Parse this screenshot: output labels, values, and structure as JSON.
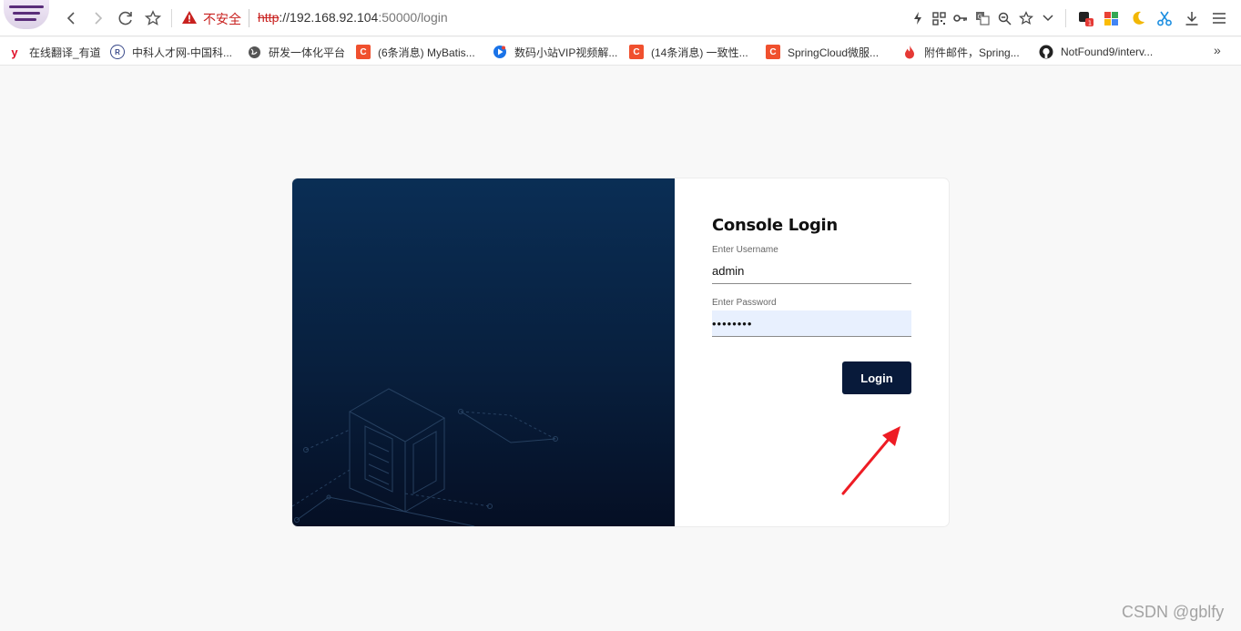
{
  "browser": {
    "address": {
      "security_label": "不安全",
      "url_scheme": "http",
      "url_host": "://192.168.92.104",
      "url_path": ":50000/login"
    },
    "icons": [
      "back-icon",
      "forward-icon",
      "reload-icon",
      "bookmark-star-icon",
      "warning-icon",
      "lightning-icon",
      "qr-code-icon",
      "key-icon",
      "translate-icon",
      "zoom-icon",
      "favorite-star-icon",
      "dropdown-icon",
      "extension-icon",
      "apps-grid-icon",
      "moon-icon",
      "scissors-icon",
      "download-icon",
      "menu-icon"
    ],
    "extension_badge": "1"
  },
  "bookmarks": [
    {
      "label": "在线翻译_有道",
      "icon": "youdao-icon",
      "color": "#e0102a"
    },
    {
      "label": "中科人才网-中国科...",
      "icon": "talent-icon",
      "color": "#3a4a8a"
    },
    {
      "label": "研发一体化平台",
      "icon": "globe-icon",
      "color": "#555555"
    },
    {
      "label": "(6条消息) MyBatis...",
      "icon": "csdn-icon",
      "color": "#f0502e"
    },
    {
      "label": "数码小站VIP视频解...",
      "icon": "video-icon",
      "color": "#1a73e8"
    },
    {
      "label": "(14条消息) 一致性...",
      "icon": "csdn-icon",
      "color": "#f0502e"
    },
    {
      "label": "SpringCloud微服...",
      "icon": "csdn-icon",
      "color": "#f0502e"
    },
    {
      "label": "附件邮件，Spring...",
      "icon": "flame-icon",
      "color": "#e53935"
    },
    {
      "label": "NotFound9/interv...",
      "icon": "github-icon",
      "color": "#222222"
    }
  ],
  "bookmarks_more": "»",
  "login": {
    "title": "Console Login",
    "username_label": "Enter Username",
    "username_value": "admin",
    "password_label": "Enter Password",
    "password_value": "••••••••",
    "button_label": "Login"
  },
  "watermark": "CSDN @gblfy"
}
